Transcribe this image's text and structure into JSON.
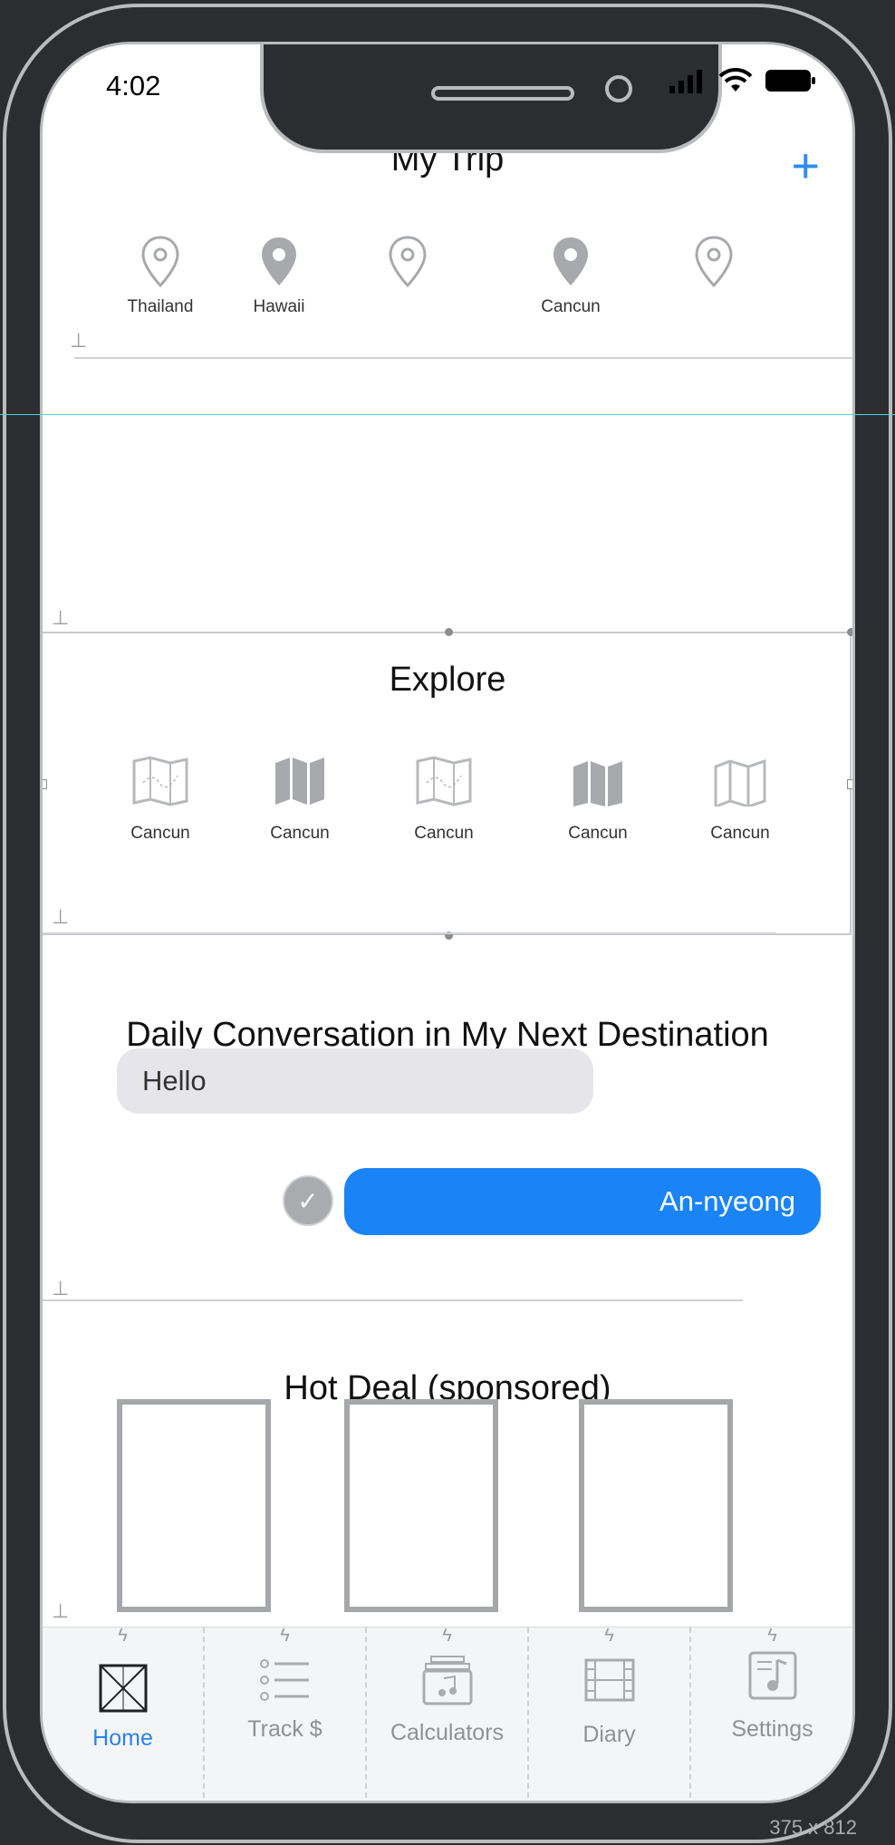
{
  "status_bar": {
    "time": "4:02"
  },
  "my_trip": {
    "title": "My Trip",
    "add_label": "+",
    "pins": [
      {
        "label": "Thailand",
        "filled": false
      },
      {
        "label": "Hawaii",
        "filled": true
      },
      {
        "label": "",
        "filled": false
      },
      {
        "label": "Cancun",
        "filled": true
      },
      {
        "label": "",
        "filled": false
      }
    ]
  },
  "explore": {
    "title": "Explore",
    "items": [
      {
        "label": "Cancun",
        "icon": "map-outline-icon"
      },
      {
        "label": "Cancun",
        "icon": "map-filled-icon"
      },
      {
        "label": "Cancun",
        "icon": "map-outline-icon"
      },
      {
        "label": "Cancun",
        "icon": "map-filled-icon"
      },
      {
        "label": "Cancun",
        "icon": "map-line-icon"
      }
    ]
  },
  "conversation": {
    "title": "Daily Conversation in My Next Destination",
    "incoming": "Hello",
    "outgoing": "An-nyeong"
  },
  "hot_deal": {
    "title": "Hot Deal (sponsored)"
  },
  "tabbar": {
    "tabs": [
      {
        "label": "Home",
        "active": true
      },
      {
        "label": "Track $",
        "active": false
      },
      {
        "label": "Calculators",
        "active": false
      },
      {
        "label": "Diary",
        "active": false
      },
      {
        "label": "Settings",
        "active": false
      }
    ]
  },
  "device_size": "375 x 812",
  "colors": {
    "accent": "#1a84f6",
    "tab_active": "#2c82e8",
    "frame": "#2c2d30"
  }
}
